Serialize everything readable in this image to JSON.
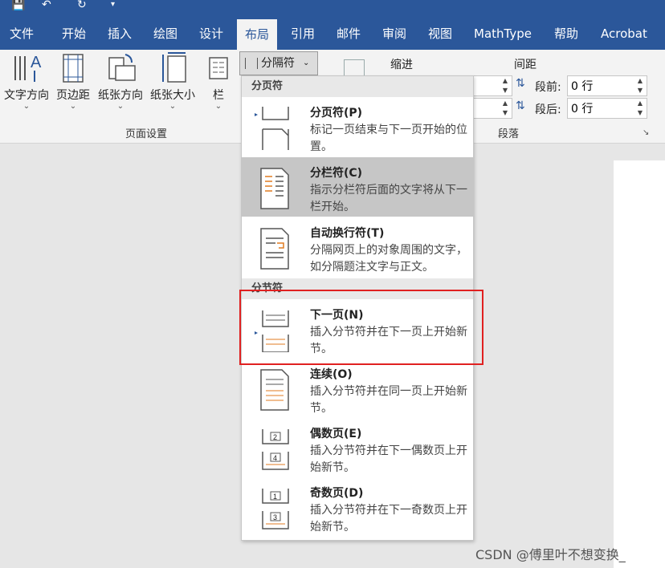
{
  "ribbon_tabs": [
    "文件",
    "开始",
    "插入",
    "绘图",
    "设计",
    "布局",
    "引用",
    "邮件",
    "审阅",
    "视图",
    "MathType",
    "帮助",
    "Acrobat"
  ],
  "active_tab": "布局",
  "page_setup": {
    "buttons": [
      "文字方向",
      "页边距",
      "纸张方向",
      "纸张大小",
      "栏"
    ],
    "group_label": "页面设置"
  },
  "breaks_button": "分隔符",
  "paragraph": {
    "indent_label": "缩进",
    "spacing_label": "间距",
    "before_label": "段前:",
    "before_value": "0 行",
    "after_label": "段后:",
    "after_value": "0 行",
    "group_label": "段落"
  },
  "dropdown": {
    "page_breaks_header": "分页符",
    "section_breaks_header": "分节符",
    "items": [
      {
        "title": "分页符(P)",
        "desc": "标记一页结束与下一页开始的位置。"
      },
      {
        "title": "分栏符(C)",
        "desc": "指示分栏符后面的文字将从下一栏开始。"
      },
      {
        "title": "自动换行符(T)",
        "desc": "分隔网页上的对象周围的文字，如分隔题注文字与正文。"
      },
      {
        "title": "下一页(N)",
        "desc": "插入分节符并在下一页上开始新节。"
      },
      {
        "title": "连续(O)",
        "desc": "插入分节符并在同一页上开始新节。"
      },
      {
        "title": "偶数页(E)",
        "desc": "插入分节符并在下一偶数页上开始新节。"
      },
      {
        "title": "奇数页(D)",
        "desc": "插入分节符并在下一奇数页上开始新节。"
      }
    ]
  },
  "watermark": "CSDN @傅里叶不想变换_",
  "colors": {
    "accent": "#2b579a",
    "highlight": "#c6c6c6",
    "annotation": "#e02020"
  }
}
